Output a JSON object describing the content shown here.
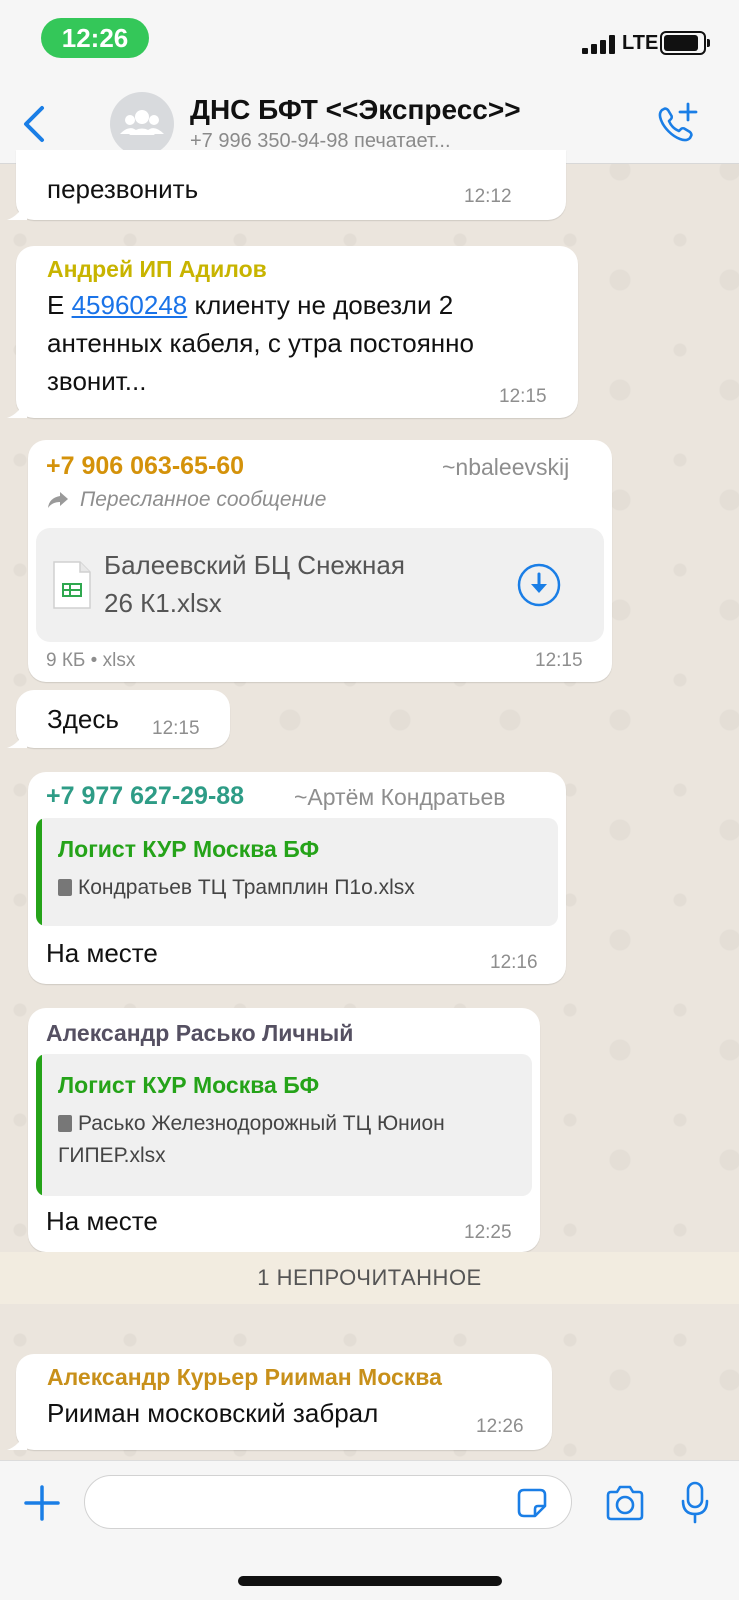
{
  "status_bar": {
    "time": "12:26",
    "network": "LTE"
  },
  "header": {
    "title": "ДНС БФТ <<Экспресс>>",
    "subtitle": "+7 996 350-94-98 печатает..."
  },
  "messages": [
    {
      "text": "перезвонить",
      "time": "12:12"
    },
    {
      "sender": "Андрей ИП Адилов",
      "sender_color": "#c8b400",
      "text_prefix": "Е ",
      "link": "45960248",
      "text_line1_rest": " клиенту не довезли 2",
      "text_line2": "антенных кабеля, с утра постоянно",
      "text_line3": "звонит...",
      "time": "12:15"
    },
    {
      "sender": "+7 906 063-65-60",
      "sender_color": "#d4920a",
      "sender_alias": "~nbaleevskij",
      "forwarded_label": "Пересланное сообщение",
      "file_name_line1": "Балеевский БЦ Снежная",
      "file_name_line2": "26 К1.xlsx",
      "file_meta": "9 КБ • xlsx",
      "time": "12:15"
    },
    {
      "text": "Здесь",
      "time": "12:15"
    },
    {
      "sender": "+7 977 627-29-88",
      "sender_color": "#2e9c86",
      "sender_alias": "~Артём Кондратьев",
      "quote_sender": "Логист КУР Москва БФ",
      "quote_file": "Кондратьев ТЦ Трамплин П1о.xlsx",
      "text": "На месте",
      "time": "12:16"
    },
    {
      "sender": "Александр Расько Личный",
      "sender_color": "#555062",
      "quote_sender": "Логист КУР Москва БФ",
      "quote_file_line1": "Расько Железнодорожный ТЦ Юнион",
      "quote_file_line2": "ГИПЕР.xlsx",
      "text": "На месте",
      "time": "12:25"
    },
    {
      "sender": "Александр Курьер Рииман Москва",
      "sender_color": "#c8901a",
      "text": "Рииман московский забрал",
      "time": "12:26"
    }
  ],
  "unread_label": "1 НЕПРОЧИТАННОЕ",
  "input": {
    "placeholder": ""
  },
  "icons": {
    "back": "chevron-left-icon",
    "call": "phone-plus-icon",
    "group": "group-avatar-icon",
    "attach": "plus-icon",
    "sticker": "sticker-icon",
    "camera": "camera-icon",
    "mic": "microphone-icon",
    "download": "download-icon",
    "spreadsheet": "spreadsheet-icon",
    "forward": "forward-arrow-icon",
    "accent": "#1a7ee6"
  }
}
